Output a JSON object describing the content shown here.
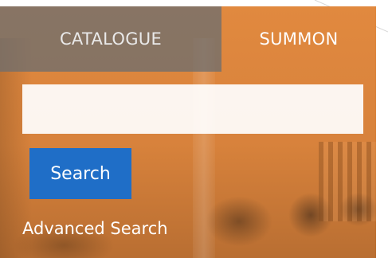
{
  "tabs": [
    {
      "label": "CATALOGUE",
      "active": false
    },
    {
      "label": "SUMMON",
      "active": true
    }
  ],
  "search": {
    "value": "",
    "placeholder": "",
    "button_label": "Search"
  },
  "links": {
    "advanced_search": "Advanced Search"
  },
  "colors": {
    "accent_orange": "#e1893f",
    "button_blue": "#1f6ec7",
    "inactive_tab_gray": "#6e6e6e"
  }
}
